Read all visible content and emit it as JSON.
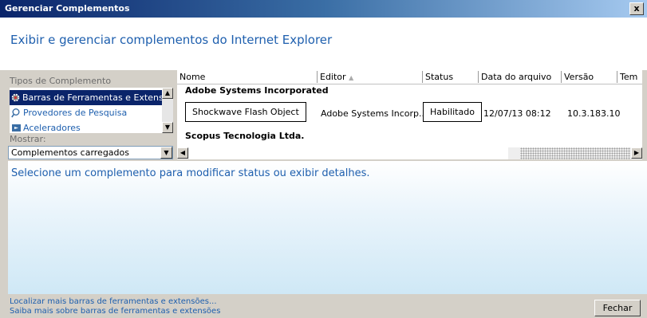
{
  "window": {
    "title": "Gerenciar Complementos",
    "close_glyph": "x"
  },
  "header": {
    "heading": "Exibir e gerenciar complementos do Internet Explorer"
  },
  "left": {
    "types_label": "Tipos de Complemento",
    "types": [
      {
        "label": "Barras de Ferramentas e Extensões",
        "icon": "gear-icon",
        "selected": true
      },
      {
        "label": "Provedores de Pesquisa",
        "icon": "search-icon",
        "selected": false
      },
      {
        "label": "Aceleradores",
        "icon": "accelerator-icon",
        "selected": false
      }
    ],
    "show_label": "Mostrar:",
    "show_value": "Complementos carregados"
  },
  "grid": {
    "columns": [
      "Nome",
      "Editor",
      "Status",
      "Data do arquivo",
      "Versão",
      "Tem"
    ],
    "sort_indicator": "▲",
    "groups": [
      {
        "name": "Adobe Systems Incorporated",
        "rows": [
          {
            "name": "Shockwave Flash Object",
            "editor": "Adobe Systems Incorp...",
            "status": "Habilitado",
            "date": "12/07/13 08:12",
            "version": "10.3.183.10"
          }
        ]
      },
      {
        "name": "Scopus Tecnologia Ltda.",
        "rows": []
      }
    ]
  },
  "detail": {
    "message": "Selecione um complemento para modificar status ou exibir detalhes."
  },
  "footer": {
    "link1": "Localizar mais barras de ferramentas e extensões...",
    "link2": "Saiba mais sobre barras de ferramentas e extensões",
    "close_button": "Fechar"
  },
  "colors": {
    "accent": "#1e5fae",
    "selection": "#0a246a",
    "titlebar": "#0a246a"
  }
}
